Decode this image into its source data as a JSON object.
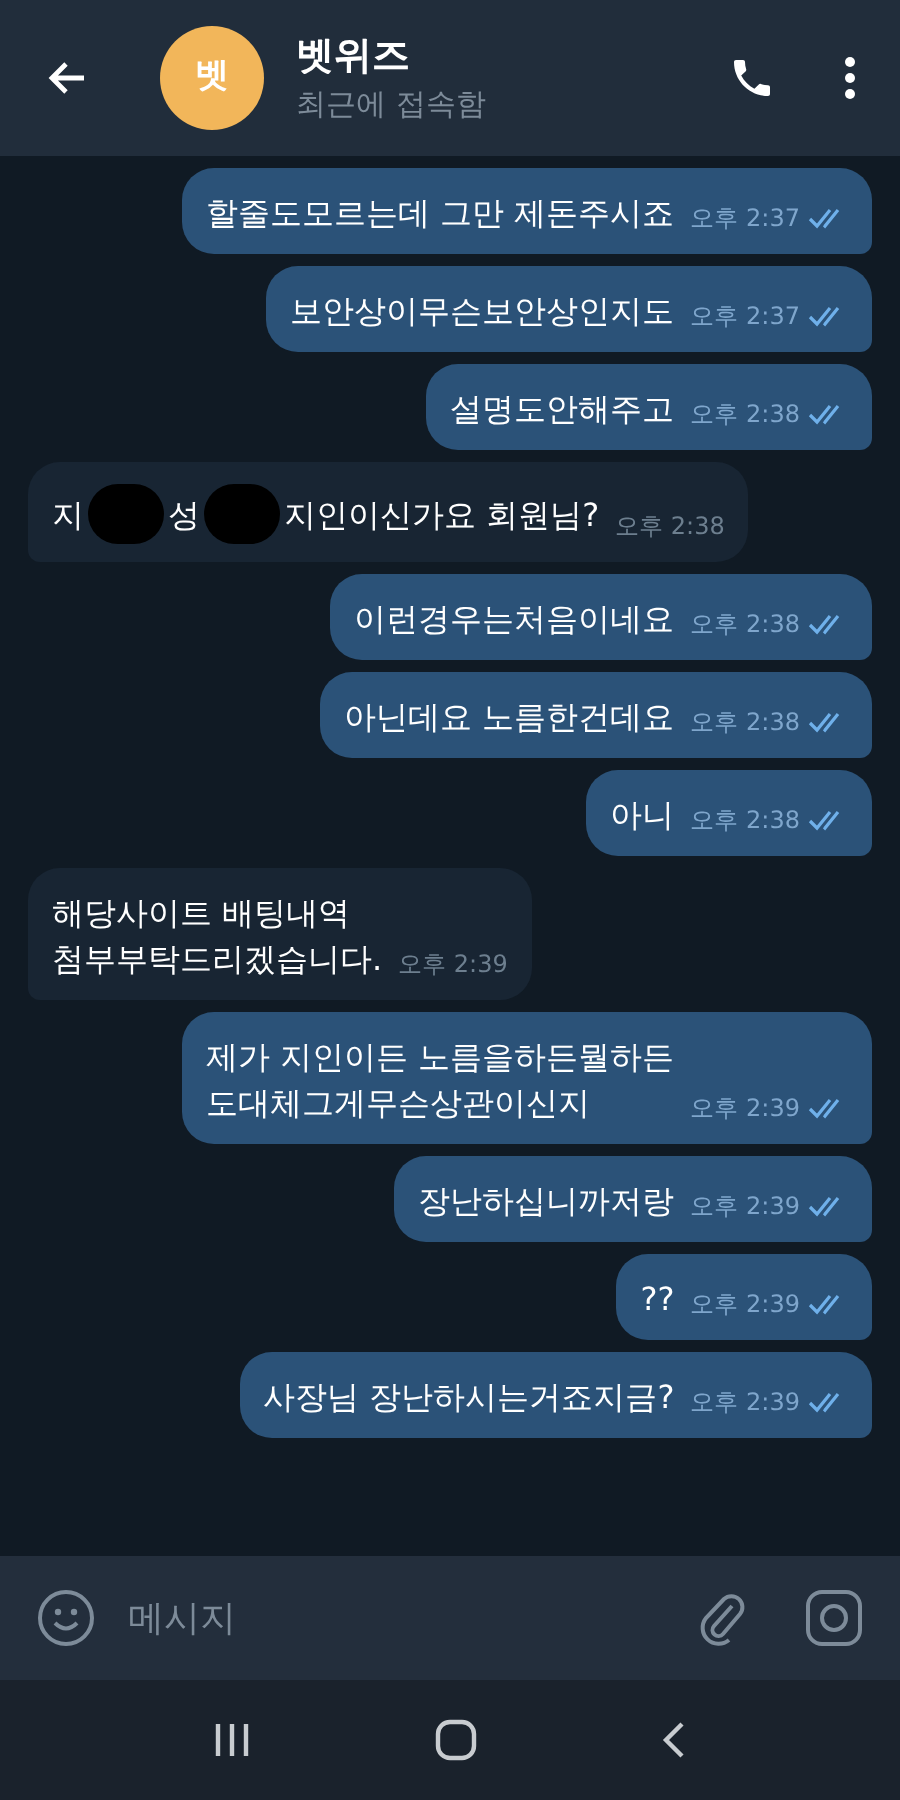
{
  "header": {
    "avatar_text": "벳",
    "title": "벳위즈",
    "status": "최근에 접속함"
  },
  "messages": [
    {
      "outgoing": true,
      "segments": [
        {
          "kind": "text",
          "text": "할줄도모르는데 그만 제돈주시죠"
        }
      ],
      "time": "오후 2:37",
      "read": true
    },
    {
      "outgoing": true,
      "segments": [
        {
          "kind": "text",
          "text": "보안상이무슨보안상인지도"
        }
      ],
      "time": "오후 2:37",
      "read": true
    },
    {
      "outgoing": true,
      "segments": [
        {
          "kind": "text",
          "text": "설명도안해주고"
        }
      ],
      "time": "오후 2:38",
      "read": true
    },
    {
      "outgoing": false,
      "segments": [
        {
          "kind": "text",
          "text": "지"
        },
        {
          "kind": "redaction"
        },
        {
          "kind": "text",
          "text": "성"
        },
        {
          "kind": "redaction"
        },
        {
          "kind": "text",
          "text": "지인이신가요 회원님?"
        }
      ],
      "time": "오후 2:38"
    },
    {
      "outgoing": true,
      "segments": [
        {
          "kind": "text",
          "text": "이런경우는처음이네요"
        }
      ],
      "time": "오후 2:38",
      "read": true
    },
    {
      "outgoing": true,
      "segments": [
        {
          "kind": "text",
          "text": "아닌데요 노름한건데요"
        }
      ],
      "time": "오후 2:38",
      "read": true
    },
    {
      "outgoing": true,
      "segments": [
        {
          "kind": "text",
          "text": "아니"
        }
      ],
      "time": "오후 2:38",
      "read": true
    },
    {
      "outgoing": false,
      "segments": [
        {
          "kind": "text",
          "text": "해당사이트 배팅내역\n첨부부탁드리겠습니다."
        }
      ],
      "time": "오후 2:39"
    },
    {
      "outgoing": true,
      "segments": [
        {
          "kind": "text",
          "text": "제가 지인이든 노름을하든뭘하든\n도대체그게무슨상관이신지"
        }
      ],
      "time": "오후 2:39",
      "read": true
    },
    {
      "outgoing": true,
      "segments": [
        {
          "kind": "text",
          "text": "장난하십니까저랑"
        }
      ],
      "time": "오후 2:39",
      "read": true
    },
    {
      "outgoing": true,
      "segments": [
        {
          "kind": "text",
          "text": "??"
        }
      ],
      "time": "오후 2:39",
      "read": true
    },
    {
      "outgoing": true,
      "segments": [
        {
          "kind": "text",
          "text": "사장님 장난하시는거죠지금?"
        }
      ],
      "time": "오후 2:39",
      "read": true
    }
  ],
  "composer": {
    "placeholder": "메시지"
  }
}
